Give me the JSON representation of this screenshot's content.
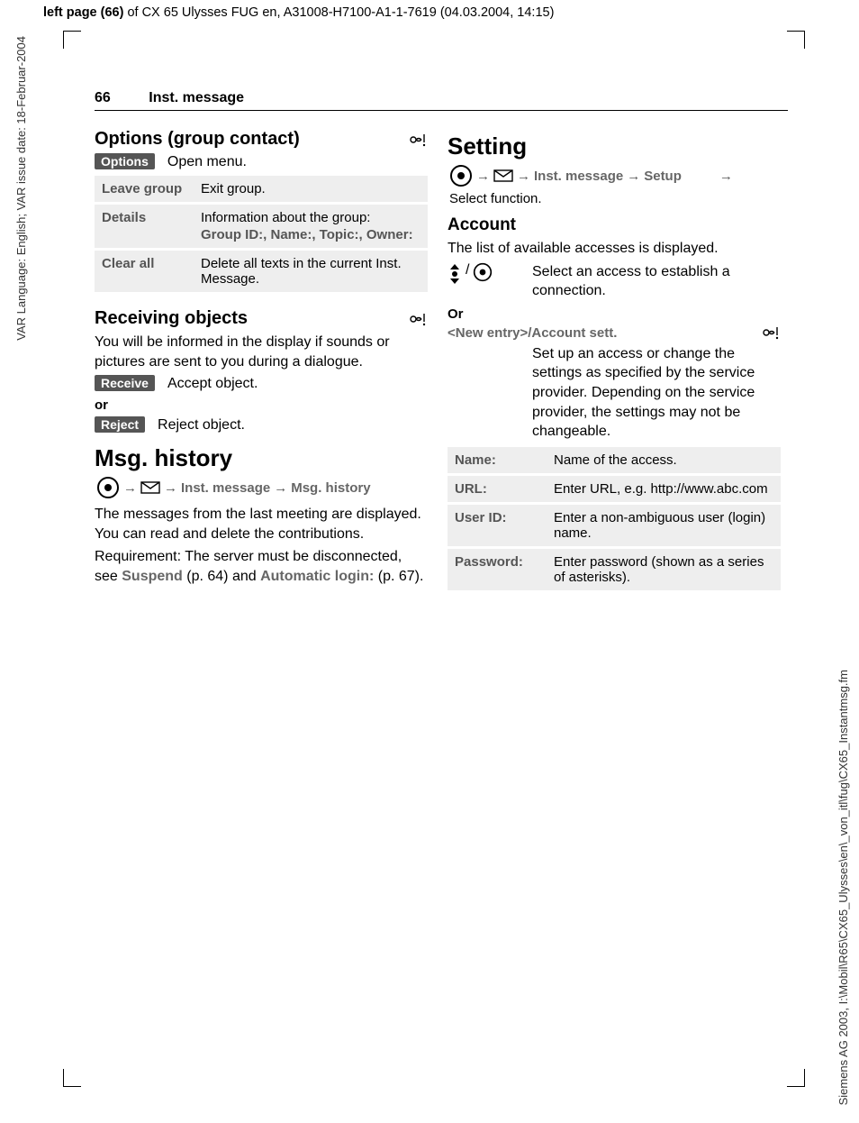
{
  "meta": {
    "top_header_bold": "left page (66)",
    "top_header_rest": " of CX 65 Ulysses FUG en, A31008-H7100-A1-1-7619 (04.03.2004, 14:15)",
    "side_left": "VAR Language: English; VAR issue date: 18-Februar-2004",
    "side_right": "Siemens AG 2003, I:\\Mobil\\R65\\CX65_Ulysses\\en\\_von_itl\\fug\\CX65_Instantmsg.fm"
  },
  "header": {
    "page_number": "66",
    "section_title": "Inst. message"
  },
  "left": {
    "h2_options": "Options (group contact)",
    "options_btn": "Options",
    "options_open": "Open menu.",
    "table": [
      {
        "k": "Leave group",
        "v": "Exit group."
      },
      {
        "k": "Details",
        "v": "Information about the group:",
        "sub": "Group ID:, Name:, Topic:, Owner:"
      },
      {
        "k": "Clear all",
        "v": "Delete all texts in the current Inst. Message."
      }
    ],
    "h2_recv": "Receiving objects",
    "recv_p": "You will be informed in the display if sounds or pictures are sent to you during a dialogue.",
    "receive_btn": "Receive",
    "receive_txt": "Accept object.",
    "or": "or",
    "reject_btn": "Reject",
    "reject_txt": "Reject object.",
    "h1_hist": "Msg. history",
    "path_inst": "Inst. message",
    "path_hist": "Msg. history",
    "hist_p1": "The messages from the last meeting are displayed. You can read and delete the contributions.",
    "hist_p2a": "Requirement: The server must be disconnected, see ",
    "hist_susp": "Suspend",
    "hist_p2b": " (p. 64) and ",
    "hist_auto": "Automatic login:",
    "hist_p2c": " (p. 67)."
  },
  "right": {
    "h1_setting": "Setting",
    "path_inst": "Inst. message",
    "path_setup": "Setup",
    "path_select": "Select function.",
    "h3_account": "Account",
    "account_p": "The list of available accesses is displayed.",
    "sel_txt": "Select an access to establish a connection.",
    "or": "Or",
    "newentry": "<New entry>/Account sett.",
    "newentry_desc": "Set up an access or change the settings as specified by the service provider. Depending on the service provider, the settings may not be changeable.",
    "table": [
      {
        "k": "Name:",
        "v": "Name of the access."
      },
      {
        "k": "URL:",
        "v": "Enter URL, e.g. http://www.abc.com"
      },
      {
        "k": "User ID:",
        "v": "Enter a non-ambiguous user (login) name."
      },
      {
        "k": "Password:",
        "v": "Enter password (shown as a series of asterisks)."
      }
    ]
  }
}
